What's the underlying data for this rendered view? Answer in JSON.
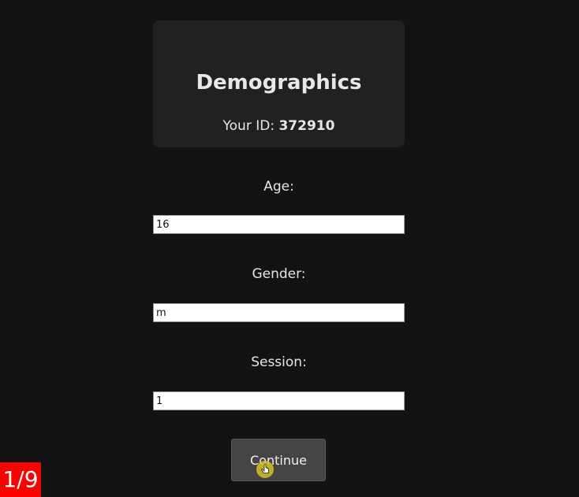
{
  "header": {
    "title": "Demographics",
    "id_label": "Your ID:",
    "id_value": "372910"
  },
  "form": {
    "age": {
      "label": "Age:",
      "value": "16"
    },
    "gender": {
      "label": "Gender:",
      "value": "m"
    },
    "session": {
      "label": "Session:",
      "value": "1"
    }
  },
  "actions": {
    "continue_label": "Continue"
  },
  "progress": {
    "counter": "1/9"
  },
  "icons": {
    "cursor": "hand-pointer-icon"
  },
  "colors": {
    "background": "#131313",
    "card": "#212121",
    "button": "#454545",
    "counter_badge": "#ff0000"
  }
}
